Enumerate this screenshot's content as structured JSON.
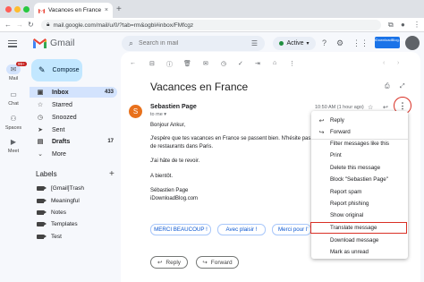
{
  "browser": {
    "tab_title": "Vacances en France - ankurti",
    "tab_close": "×",
    "new_tab": "+",
    "url": "mail.google.com/mail/u/0/?tab=rm&ogbl#inbox/FMfcgz"
  },
  "header": {
    "logo": "Gmail",
    "search_placeholder": "Search in mail",
    "status": "Active",
    "brand_badge": "iDownloadBlog.com"
  },
  "rail": {
    "mail_badge": "99+",
    "items": [
      {
        "label": "Mail"
      },
      {
        "label": "Chat"
      },
      {
        "label": "Spaces"
      },
      {
        "label": "Meet"
      }
    ]
  },
  "sidebar": {
    "compose": "Compose",
    "items": [
      {
        "label": "Inbox",
        "count": "433"
      },
      {
        "label": "Starred",
        "count": ""
      },
      {
        "label": "Snoozed",
        "count": ""
      },
      {
        "label": "Sent",
        "count": ""
      },
      {
        "label": "Drafts",
        "count": "17"
      },
      {
        "label": "More",
        "count": ""
      }
    ],
    "labels_heading": "Labels",
    "labels": [
      "[Gmail]Trash",
      "Meaningful",
      "Notes",
      "Templates",
      "Test"
    ]
  },
  "email": {
    "subject": "Vacances en France",
    "sender_initial": "S",
    "sender": "Sebastien Page",
    "to": "to me",
    "time": "10:50 AM (1 hour ago)",
    "body": [
      "Bonjour Ankur,",
      "J'espère que tes vacances en France se passent bien. N'hésite pas à me",
      "de restaurants dans Paris.",
      "J'ai hâte de te revoir.",
      "A bientôt.",
      "Sébastien Page",
      "iDownloadBlog.com"
    ],
    "smart_replies": [
      "MERCI BEAUCOUP !",
      "Avec plaisir !",
      "Merci pour l'"
    ],
    "reply": "Reply",
    "forward": "Forward"
  },
  "menu": {
    "items": [
      {
        "label": "Reply",
        "icon": "reply-icon"
      },
      {
        "label": "Forward",
        "icon": "forward-icon"
      },
      {
        "label": "Filter messages like this"
      },
      {
        "label": "Print"
      },
      {
        "label": "Delete this message"
      },
      {
        "label": "Block \"Sebastien Page\""
      },
      {
        "label": "Report spam"
      },
      {
        "label": "Report phishing"
      },
      {
        "label": "Show original"
      },
      {
        "label": "Translate message"
      },
      {
        "label": "Download message"
      },
      {
        "label": "Mark as unread"
      }
    ],
    "highlighted": "Translate message"
  },
  "colors": {
    "accent": "#0b57d0",
    "highlight_ring": "#d93025",
    "avatar": "#e8711c",
    "active": "#1e8e3e"
  }
}
